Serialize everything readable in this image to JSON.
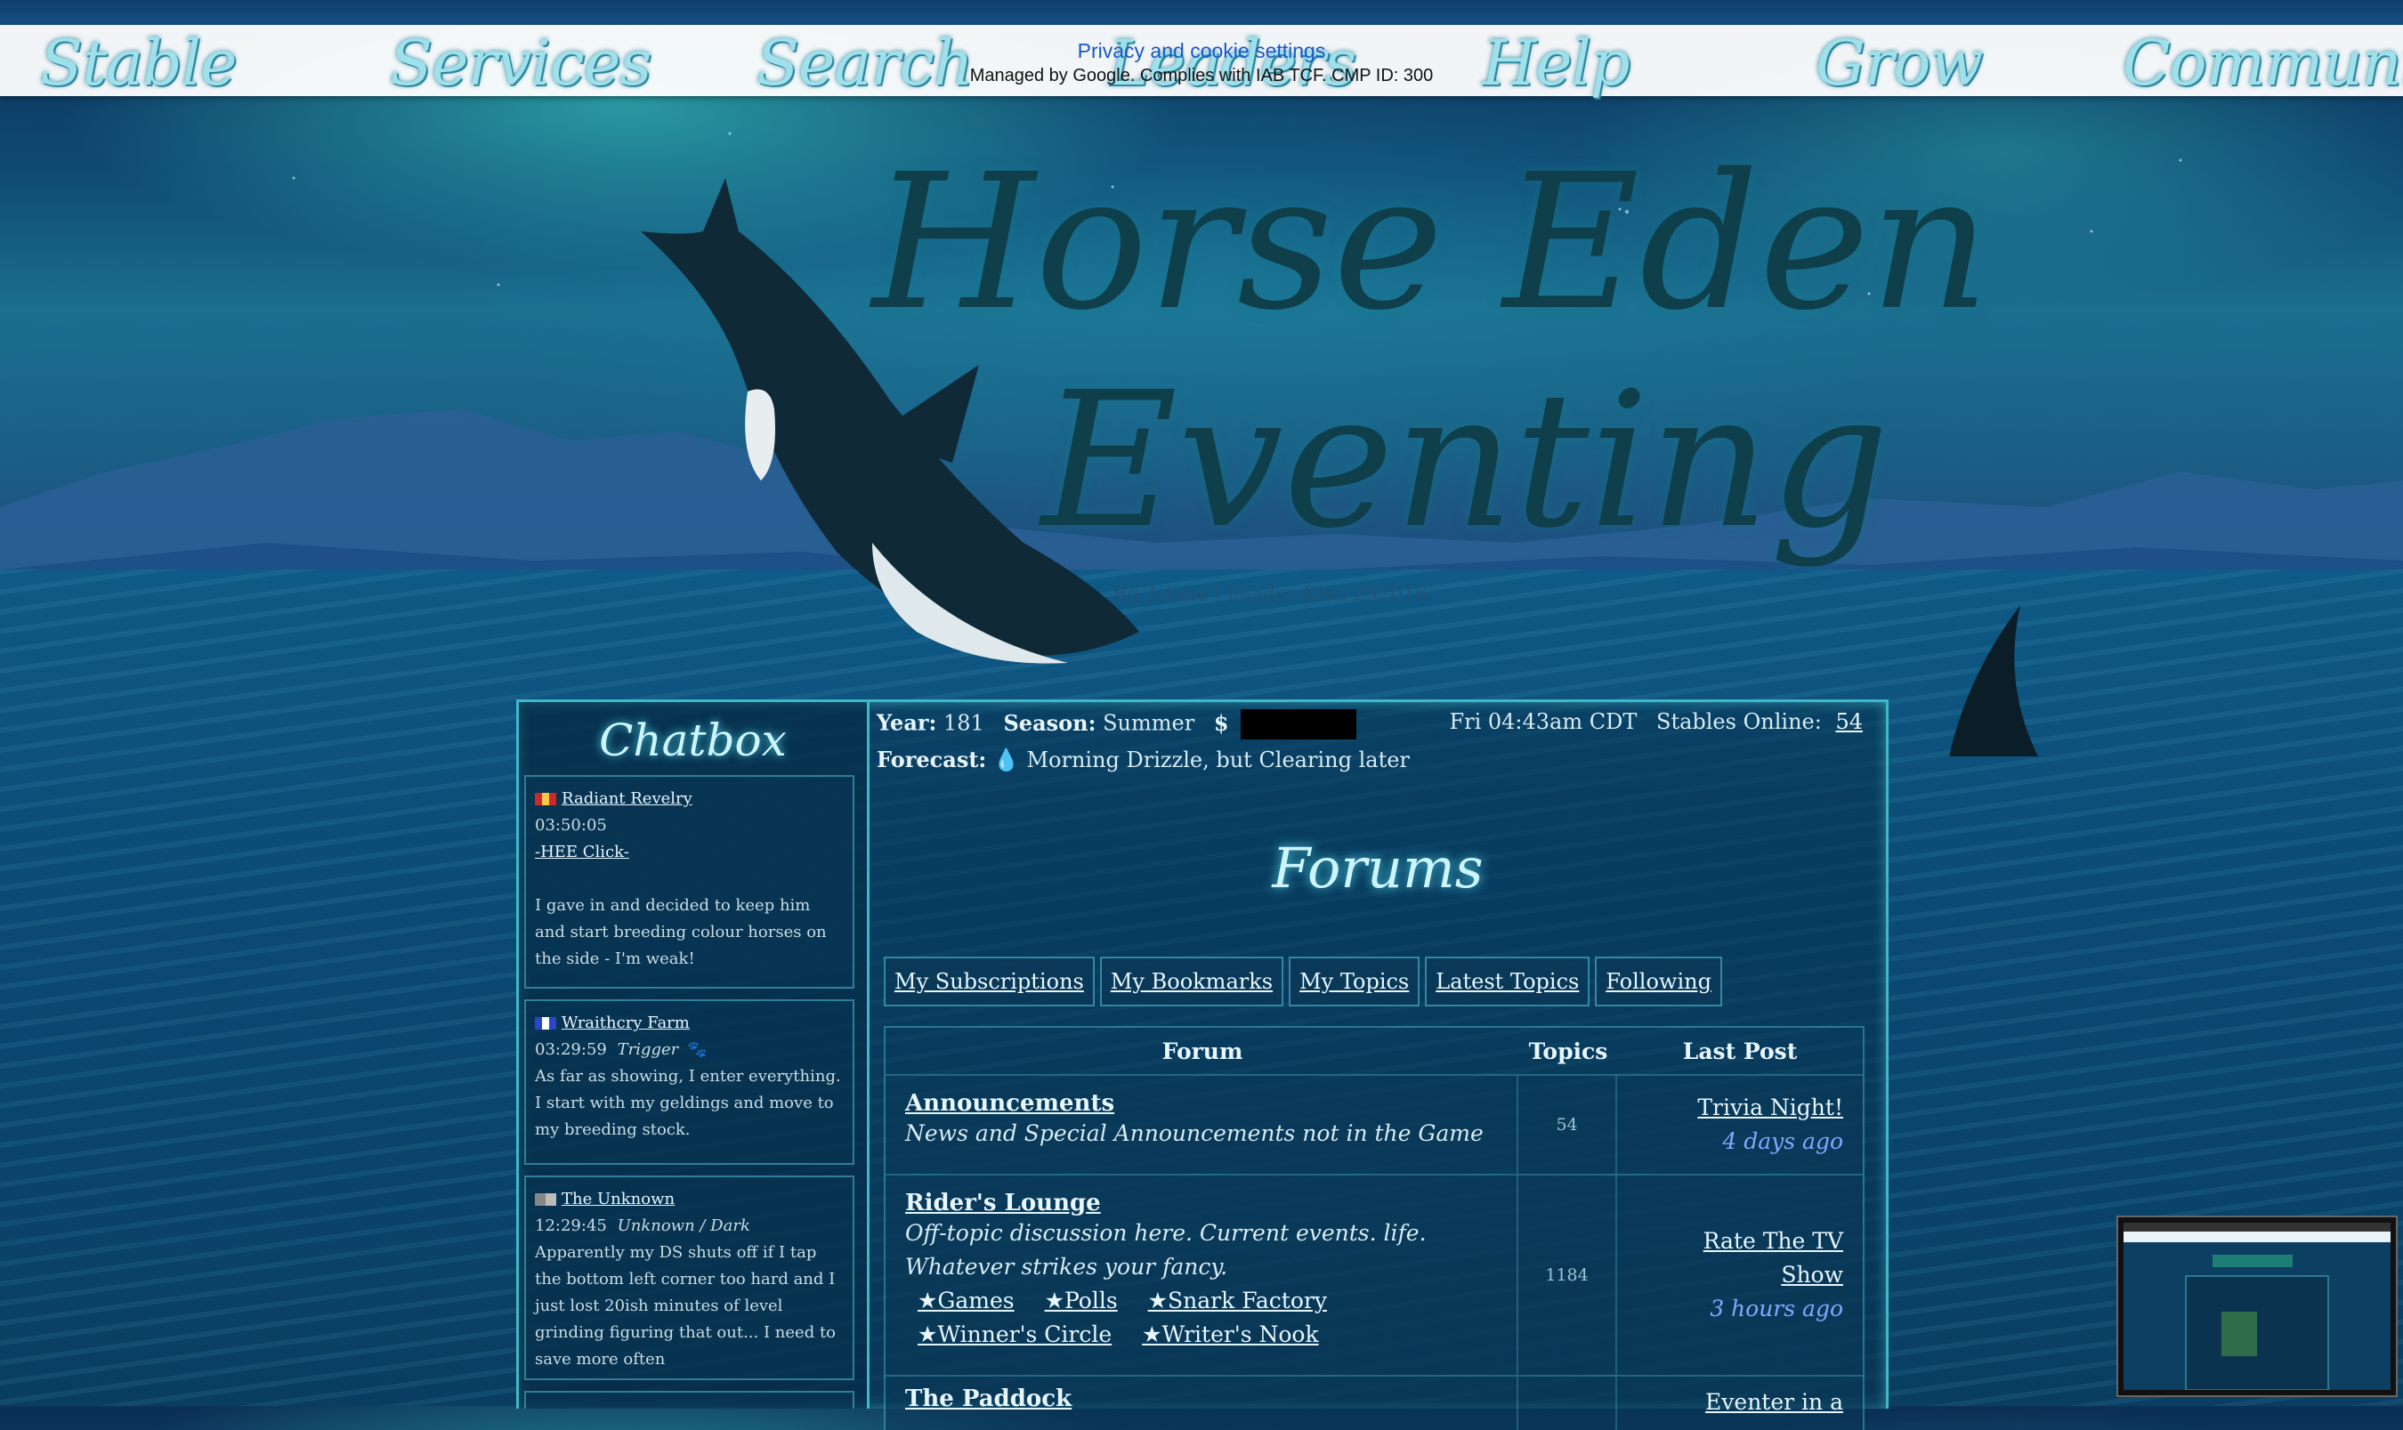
{
  "nav": {
    "items": [
      "Stable",
      "Services",
      "Search",
      "Leaders",
      "Help",
      "Grow",
      "Community"
    ]
  },
  "cookie": {
    "link": "Privacy and cookie settings",
    "managed": "Managed by Google. Complies with IAB TCF. CMP ID: 300"
  },
  "header": {
    "title_line1": "Horse Eden",
    "title_line2": "Eventing",
    "credit": "Bg Adobe | header Kiwi 292016"
  },
  "chatbox": {
    "title": "Chatbox",
    "messages": [
      {
        "user": "Radiant Revelry",
        "time": "03:50:05",
        "tag": "-HEE Click-",
        "text": "I gave in and decided to keep him and start breeding colour horses on the side - I'm weak!"
      },
      {
        "user": "Wraithcry Farm",
        "time": "03:29:59",
        "tag": "Trigger",
        "text": "As far as showing, I enter everything. I start with my geldings and move to my breeding stock."
      },
      {
        "user": "The Unknown",
        "time": "12:29:45",
        "tag": "Unknown / Dark",
        "text": "Apparently my DS shuts off if I tap the bottom left corner too hard and I just lost 20ish minutes of level grinding figuring that out... I need to save more often"
      }
    ]
  },
  "status": {
    "year_label": "Year:",
    "year": "181",
    "season_label": "Season:",
    "season": "Summer",
    "money_symbol": "$",
    "time": "Fri 04:43am CDT",
    "stables_label": "Stables Online:",
    "stables_online": "54",
    "forecast_label": "Forecast:",
    "forecast": "Morning Drizzle, but Clearing later"
  },
  "forums": {
    "title": "Forums",
    "tabs": [
      "My Subscriptions",
      "My Bookmarks",
      "My Topics",
      "Latest Topics",
      "Following"
    ],
    "headers": {
      "forum": "Forum",
      "topics": "Topics",
      "last_post": "Last Post"
    },
    "rows": [
      {
        "name": "Announcements",
        "desc": "News and Special Announcements not in the Game",
        "topics": "54",
        "last_title": "Trivia Night!",
        "last_time": "4 days ago"
      },
      {
        "name": "Rider's Lounge",
        "desc": "Off-topic discussion here. Current events. life. Whatever strikes your fancy.",
        "topics": "1184",
        "last_title": "Rate The TV Show",
        "last_time": "3 hours ago",
        "subs": [
          "★Games",
          "★Polls",
          "★Snark Factory",
          "★Winner's Circle",
          "★Writer's Nook"
        ]
      },
      {
        "name": "The Paddock",
        "last_title": "Eventer in a"
      }
    ]
  }
}
